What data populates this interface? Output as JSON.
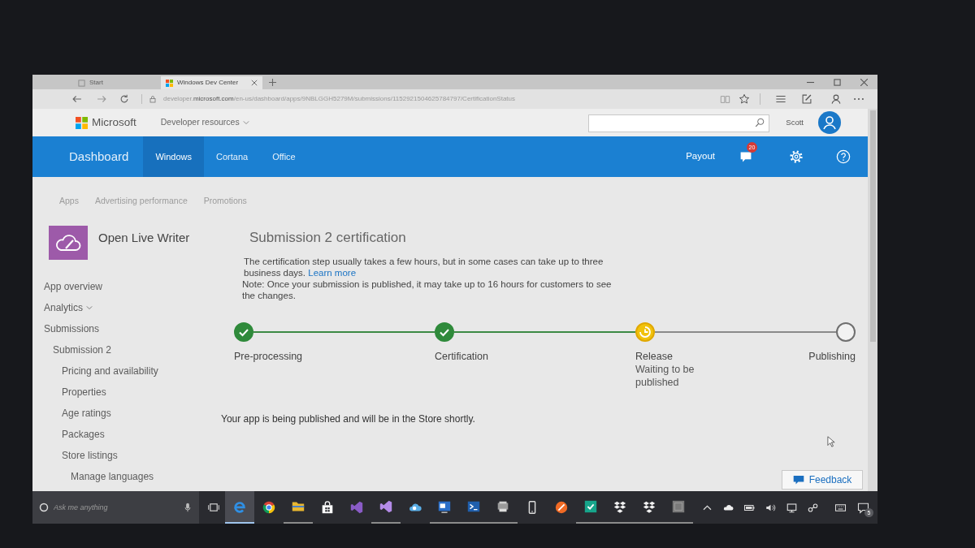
{
  "browser": {
    "tabs": [
      {
        "label": "Start",
        "selected": false
      },
      {
        "label": "Windows Dev Center",
        "selected": true
      }
    ],
    "address": "developer.**microsoft.com**/en-us/dashboard/apps/9NBLGGH5279M/submissions/1152921504625784797/CertificationStatus"
  },
  "header": {
    "brand": "Microsoft",
    "menu": "Developer resources",
    "user": "Scott"
  },
  "nav": {
    "title": "Dashboard",
    "items": [
      {
        "label": "Windows",
        "selected": true
      },
      {
        "label": "Cortana",
        "selected": false
      },
      {
        "label": "Office",
        "selected": false
      }
    ],
    "payout": "Payout",
    "notification_count": "20"
  },
  "subnav": {
    "items": [
      {
        "label": "Apps"
      },
      {
        "label": "Advertising performance"
      },
      {
        "label": "Promotions"
      }
    ]
  },
  "app": {
    "name": "Open Live Writer"
  },
  "sidebar": {
    "items": [
      {
        "label": "App overview",
        "kind": "link"
      },
      {
        "label": "Analytics",
        "kind": "menu"
      },
      {
        "label": "Submissions",
        "kind": "link",
        "children": [
          {
            "label": "Submission 2",
            "kind": "link",
            "children": [
              {
                "label": "Pricing and availability",
                "kind": "link"
              },
              {
                "label": "Properties",
                "kind": "link"
              },
              {
                "label": "Age ratings",
                "kind": "link"
              },
              {
                "label": "Packages",
                "kind": "link"
              },
              {
                "label": "Store listings",
                "kind": "link",
                "children": [
                  {
                    "label": "Manage languages",
                    "kind": "link"
                  }
                ]
              }
            ]
          }
        ]
      }
    ]
  },
  "certification": {
    "title": "Submission 2 certification",
    "intro": "The certification step usually takes a few hours, but in some cases can take up to three business days.",
    "link": "Learn more",
    "note": "Note: Once your submission is published, it may take up to 16 hours for customers to see the changes.",
    "steps": [
      {
        "label": "Pre-processing",
        "complete": true,
        "active": false
      },
      {
        "label": "Certification",
        "complete": true,
        "active": false
      },
      {
        "label": "Release",
        "complete": false,
        "active": true,
        "detail": "Waiting to be published"
      },
      {
        "label": "Publishing",
        "complete": false,
        "active": false
      }
    ],
    "message": "Your app is being published and will be in the Store shortly."
  },
  "feedback": {
    "label": "Feedback"
  },
  "taskbar": {
    "search_placeholder": "Ask me anything",
    "apps": [
      {
        "selected": true,
        "running": true
      },
      {
        "selected": false,
        "running": false
      },
      {
        "selected": false,
        "running": true
      },
      {
        "selected": false,
        "running": false
      },
      {
        "selected": false,
        "running": false
      },
      {
        "selected": false,
        "running": true
      },
      {
        "selected": false,
        "running": false
      },
      {
        "selected": false,
        "running": true
      },
      {
        "selected": false,
        "running": true
      },
      {
        "selected": false,
        "running": true
      },
      {
        "selected": false,
        "running": false
      },
      {
        "selected": false,
        "running": false
      },
      {
        "selected": false,
        "running": true
      },
      {
        "selected": false,
        "running": true
      },
      {
        "selected": false,
        "running": true
      },
      {
        "selected": false,
        "running": true
      }
    ],
    "notification_count": "5"
  }
}
